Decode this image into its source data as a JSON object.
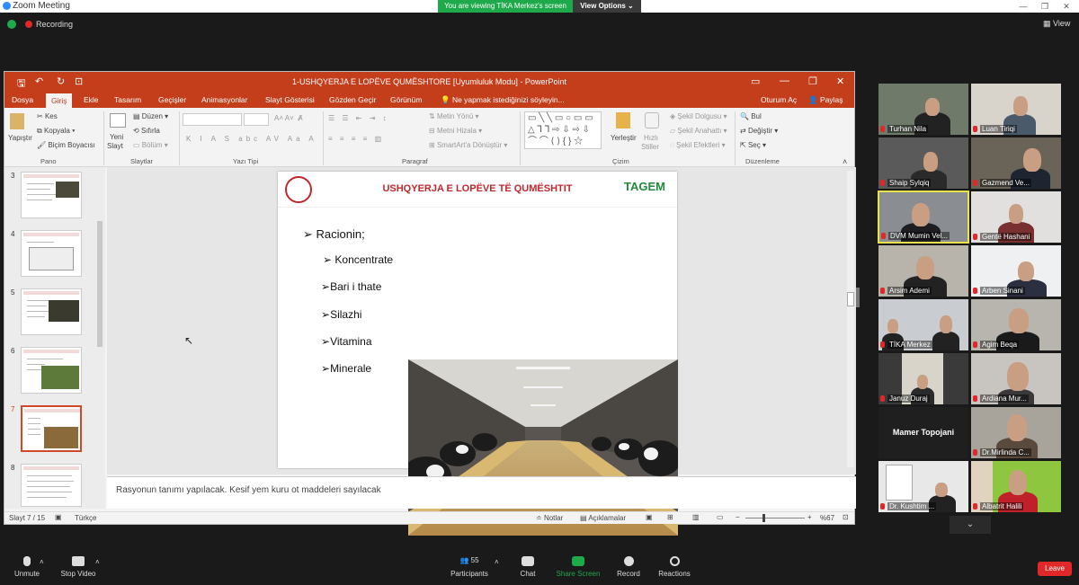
{
  "zoom": {
    "window_title": "Zoom Meeting",
    "viewing_banner": "You are viewing TİKA Merkez's screen",
    "view_options": "View Options",
    "recording": "Recording",
    "view_button": "View",
    "bottom": {
      "unmute": "Unmute",
      "stop_video": "Stop Video",
      "participants": "Participants",
      "participants_count": "55",
      "chat": "Chat",
      "share_screen": "Share Screen",
      "record": "Record",
      "reactions": "Reactions",
      "leave": "Leave"
    }
  },
  "ppt": {
    "title": "1-USHQYERJA E LOPËVE QUMËSHTORE [Uyumluluk Modu] - PowerPoint",
    "tabs": [
      "Dosya",
      "Giriş",
      "Ekle",
      "Tasarım",
      "Geçişler",
      "Animasyonlar",
      "Slayt Gösterisi",
      "Gözden Geçir",
      "Görünüm"
    ],
    "tell_me": "Ne yapmak istediğinizi söyleyin...",
    "sign_in": "Oturum Aç",
    "share": "Paylaş",
    "ribbon": {
      "paste": "Yapıştır",
      "cut": "Kes",
      "copy": "Kopyala",
      "format_painter": "Biçim Boyacısı",
      "group_clipboard": "Pano",
      "new_slide": "Yeni",
      "new_slide2": "Slayt",
      "layout": "Düzen",
      "reset": "Sıfırla",
      "section": "Bölüm",
      "group_slides": "Slaytlar",
      "group_font": "Yazı Tipi",
      "text_direction": "Metin Yönü",
      "align_text": "Metni Hizala",
      "smartart": "SmartArt'a Dönüştür",
      "group_paragraph": "Paragraf",
      "arrange": "Yerleştir",
      "quick_styles": "Hızlı",
      "quick_styles2": "Stiller",
      "shape_fill": "Şekil Dolgusu",
      "shape_outline": "Şekil Anahattı",
      "shape_effects": "Şekil Efektleri",
      "group_drawing": "Çizim",
      "find": "Bul",
      "replace": "Değiştir",
      "select": "Seç",
      "group_editing": "Düzenleme"
    },
    "thumb_numbers": [
      "3",
      "4",
      "5",
      "6",
      "7",
      "8"
    ],
    "slide": {
      "title": "USHQYERJA E LOPËVE TË QUMËSHTIT",
      "logo": "TAGEM",
      "heading": "Racionin;",
      "bullets": [
        "Koncentrate",
        "Bari i thate",
        "Silazhi",
        "Vitamina",
        "Minerale"
      ]
    },
    "notes": "Rasyonun tanımı yapılacak. Kesif yem kuru ot maddeleri sayılacak",
    "status": {
      "slide": "Slayt 7 / 15",
      "language": "Türkçe",
      "notes": "Notlar",
      "comments": "Açıklamalar",
      "zoom": "%67"
    }
  },
  "participants": [
    {
      "name": "Turhan Nila"
    },
    {
      "name": "Luan Tiriqi"
    },
    {
      "name": "Shaip Sylqiq"
    },
    {
      "name": "Gazmend Ve..."
    },
    {
      "name": "DVM Mumin Vel..."
    },
    {
      "name": "Gentë Hashani"
    },
    {
      "name": "Arsim Ademi"
    },
    {
      "name": "Arben Sinani"
    },
    {
      "name": "TİKA Merkez"
    },
    {
      "name": "Agim Beqa"
    },
    {
      "name": "Januz Duraj"
    },
    {
      "name": "Ardiana Mur..."
    },
    {
      "name": "Mamer Topojani"
    },
    {
      "name": "Dr.Mirlinda C..."
    },
    {
      "name": "Dr. Kushtim ..."
    },
    {
      "name": "Albatrit Halili"
    }
  ]
}
